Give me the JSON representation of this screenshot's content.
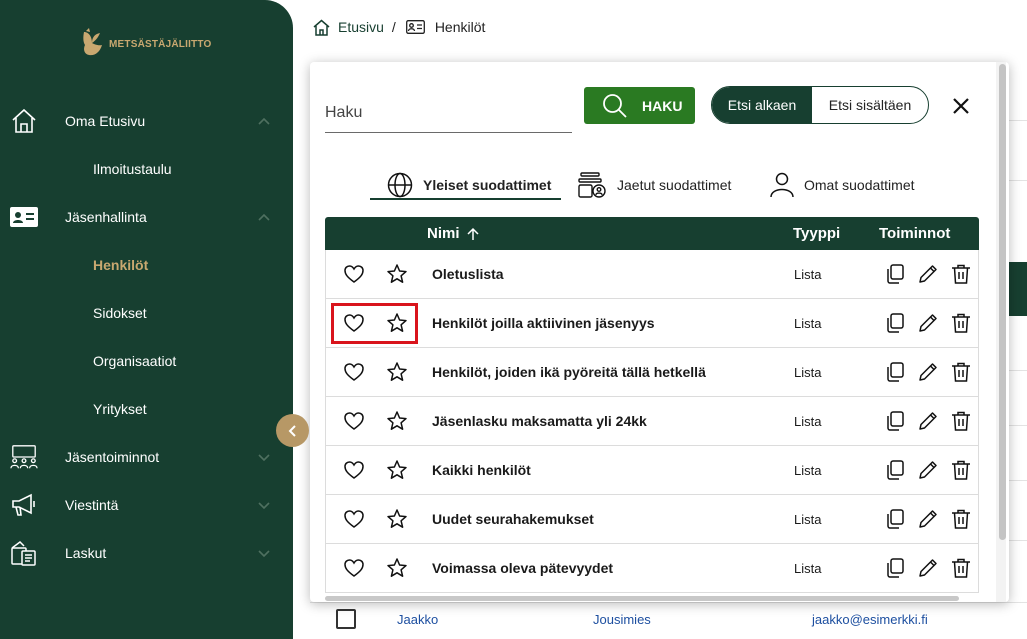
{
  "sidebar": {
    "logo_text": "METSÄSTÄJÄLIITTO",
    "items": [
      {
        "label": "Oma Etusivu",
        "icon": "home-icon"
      },
      {
        "label": "Jäsenhallinta",
        "icon": "id-card-icon"
      },
      {
        "label": "Jäsentoiminnot",
        "icon": "people-group-icon"
      },
      {
        "label": "Viestintä",
        "icon": "megaphone-icon"
      },
      {
        "label": "Laskut",
        "icon": "invoice-icon"
      }
    ],
    "subitems": {
      "ilmoitustaulu": "Ilmoitustaulu",
      "henkilot": "Henkilöt",
      "sidokset": "Sidokset",
      "organisaatiot": "Organisaatiot",
      "yritykset": "Yritykset"
    }
  },
  "breadcrumb": {
    "home": "Etusivu",
    "separator": "/",
    "current": "Henkilöt"
  },
  "modal": {
    "search_placeholder": "Haku",
    "search_button": "HAKU",
    "toggle": {
      "option1": "Etsi alkaen",
      "option2": "Etsi sisältäen"
    },
    "tabs": [
      "Yleiset suodattimet",
      "Jaetut suodattimet",
      "Omat suodattimet"
    ],
    "columns": {
      "name": "Nimi",
      "type": "Tyyppi",
      "actions": "Toiminnot"
    },
    "rows": [
      {
        "name": "Oletuslista",
        "type": "Lista"
      },
      {
        "name": "Henkilöt joilla aktiivinen jäsenyys",
        "type": "Lista"
      },
      {
        "name": "Henkilöt, joiden ikä pyöreitä tällä hetkellä",
        "type": "Lista"
      },
      {
        "name": "Jäsenlasku maksamatta yli 24kk",
        "type": "Lista"
      },
      {
        "name": "Kaikki henkilöt",
        "type": "Lista"
      },
      {
        "name": "Uudet seurahakemukset",
        "type": "Lista"
      },
      {
        "name": "Voimassa oleva pätevyydet",
        "type": "Lista"
      }
    ]
  },
  "background_row": {
    "first_name": "Jaakko",
    "last_name": "Jousimies",
    "email": "jaakko@esimerkki.fi"
  },
  "colors": {
    "sidebar": "#173f30",
    "accent_gold": "#c9a870",
    "search_button": "#2a7a22",
    "highlight": "#d9141c"
  }
}
